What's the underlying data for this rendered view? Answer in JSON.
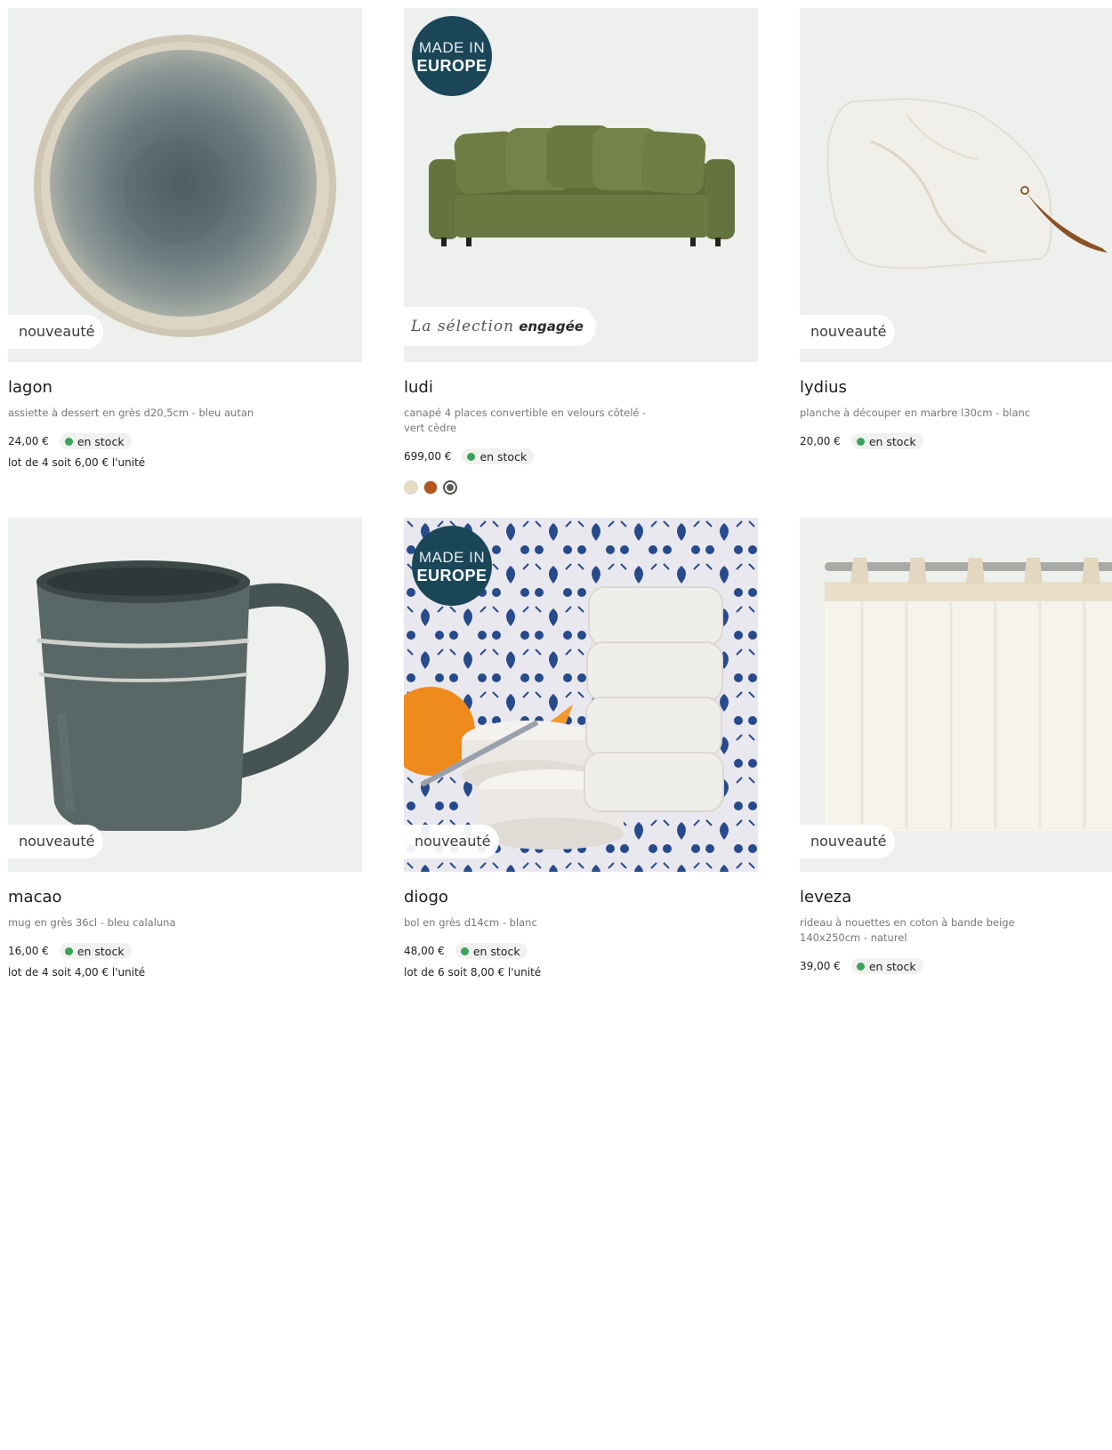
{
  "badges": {
    "new": "nouveauté",
    "made_in_line1": "MADE IN",
    "made_in_line2": "EUROPE",
    "selection_script": "La sélection",
    "selection_bold": "engagée"
  },
  "products": [
    {
      "name": "lagon",
      "description": "assiette à dessert en grès d20,5cm - bleu autan",
      "price": "24,00 €",
      "stock": "en stock",
      "lot": "lot de 4 soit 6,00 € l'unité",
      "image": "plate"
    },
    {
      "name": "ludi",
      "description": "canapé 4 places convertible en velours côtelé - vert cèdre",
      "price": "699,00 €",
      "stock": "en stock",
      "image": "sofa",
      "swatch_colors": [
        "#e9dcc4",
        "#b4541a",
        "#5b6157"
      ]
    },
    {
      "name": "lydius",
      "description": "planche à découper en marbre l30cm - blanc",
      "price": "20,00 €",
      "stock": "en stock",
      "image": "marble-board"
    },
    {
      "name": "macao",
      "description": "mug en grès 36cl - bleu calaluna",
      "price": "16,00 €",
      "stock": "en stock",
      "lot": "lot de 4 soit 4,00 € l'unité",
      "image": "mug"
    },
    {
      "name": "diogo",
      "description": "bol en grès d14cm - blanc",
      "price": "48,00 €",
      "stock": "en stock",
      "lot": "lot de 6 soit 8,00 € l'unité",
      "image": "bowls"
    },
    {
      "name": "leveza",
      "description": "rideau à nouettes en coton à bande beige 140x250cm - naturel",
      "price": "39,00 €",
      "stock": "en stock",
      "image": "curtain"
    }
  ],
  "colors": {
    "stock_dot": "#3aa35b",
    "image_bg": "#edf0ec",
    "made_in_badge": "#1a4658"
  }
}
